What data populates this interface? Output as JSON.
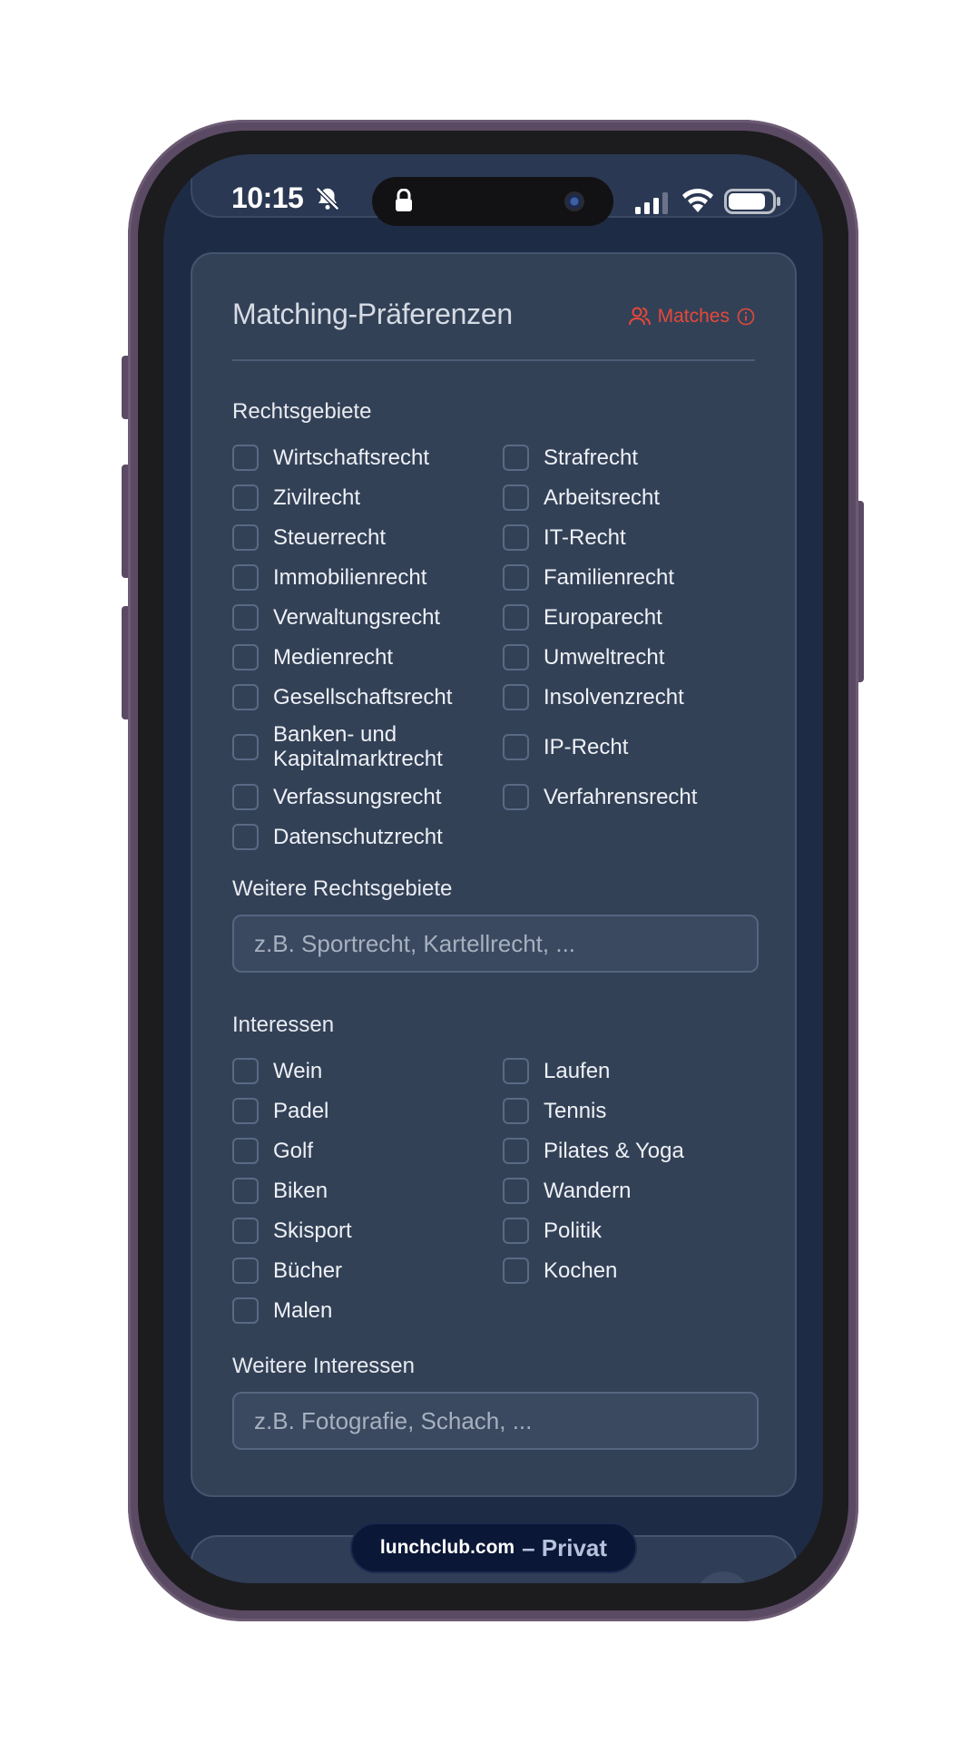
{
  "status_bar": {
    "time": "10:15",
    "icons": [
      "bell-slash-icon",
      "lock-icon",
      "signal-icon",
      "wifi-icon",
      "battery-icon"
    ]
  },
  "card": {
    "title": "Matching-Präferenzen",
    "matches_label": "Matches",
    "accent_color": "#e5483a"
  },
  "rechtsgebiete": {
    "label": "Rechtsgebiete",
    "items": [
      "Wirtschaftsrecht",
      "Strafrecht",
      "Zivilrecht",
      "Arbeitsrecht",
      "Steuerrecht",
      "IT-Recht",
      "Immobilienrecht",
      "Familienrecht",
      "Verwaltungsrecht",
      "Europarecht",
      "Medienrecht",
      "Umweltrecht",
      "Gesellschaftsrecht",
      "Insolvenzrecht",
      "Banken- und Kapitalmarktrecht",
      "IP-Recht",
      "Verfassungsrecht",
      "Verfahrensrecht",
      "Datenschutzrecht"
    ]
  },
  "weitere_rechtsgebiete": {
    "label": "Weitere Rechtsgebiete",
    "placeholder": "z.B. Sportrecht, Kartellrecht, ...",
    "value": ""
  },
  "interessen": {
    "label": "Interessen",
    "items": [
      "Wein",
      "Laufen",
      "Padel",
      "Tennis",
      "Golf",
      "Pilates & Yoga",
      "Biken",
      "Wandern",
      "Skisport",
      "Politik",
      "Bücher",
      "Kochen",
      "Malen"
    ]
  },
  "weitere_interessen": {
    "label": "Weitere Interessen",
    "placeholder": "z.B. Fotografie, Schach, ...",
    "value": ""
  },
  "browser": {
    "host": "lunchclub.com",
    "mode": "– Privat"
  }
}
